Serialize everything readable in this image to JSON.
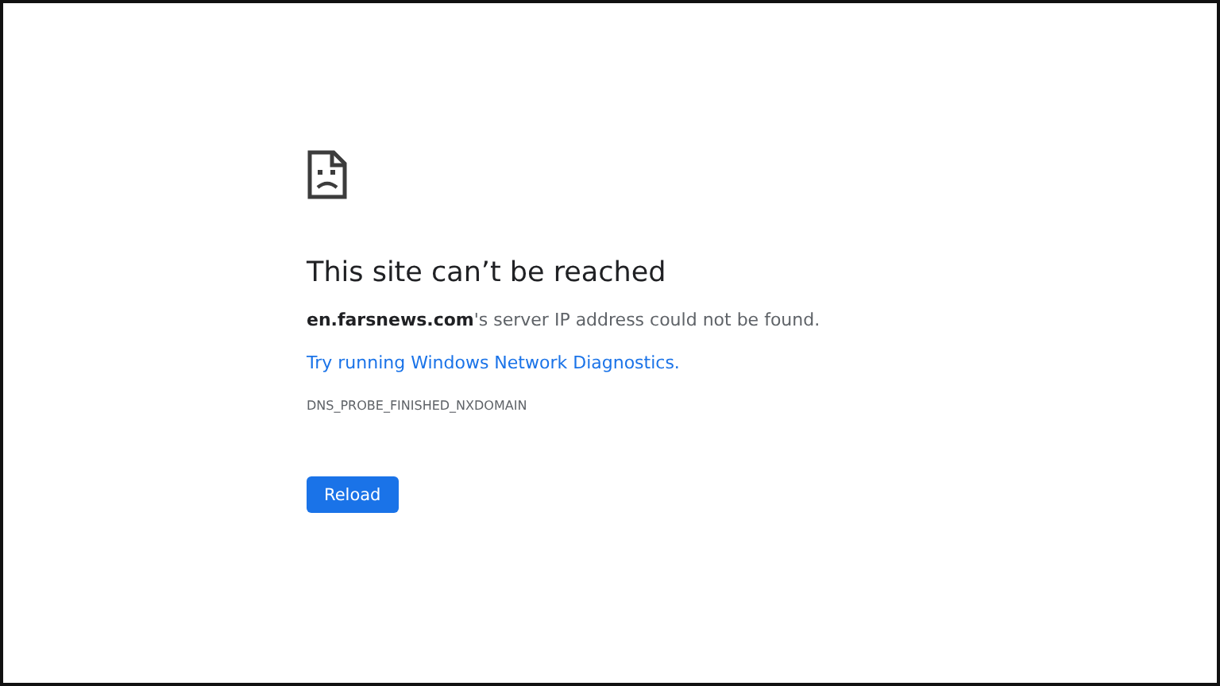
{
  "error_page": {
    "title": "This site can’t be reached",
    "message": "**en.farsnews.com**'s server IP address could not be found.",
    "link": "Try running Windows Network Diagnostics.",
    "error_code": "DNS_PROBE_FINISHED_NXDOMAIN",
    "button": "Reload"
  }
}
